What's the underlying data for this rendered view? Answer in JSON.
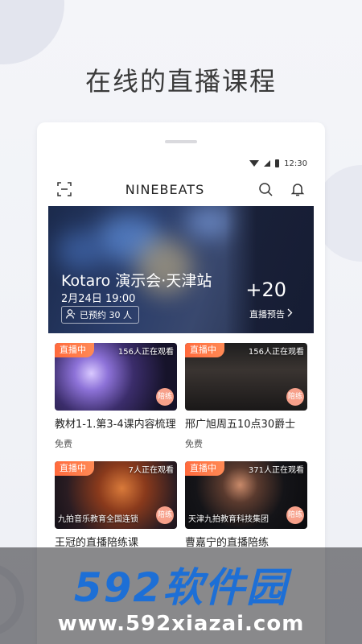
{
  "headline": "在线的直播课程",
  "status": {
    "time": "12:30"
  },
  "nav": {
    "brand": "NINEBEATS"
  },
  "hero": {
    "title": "Kotaro 演示会·天津站",
    "date": "2月24日 19:00",
    "booked": "已预约 30 人",
    "count": "+20",
    "link": "直播预告"
  },
  "cards": [
    {
      "tag": "直播中",
      "viewers": "156人正在观看",
      "title": "教材1-1.第3-4课内容梳理",
      "price": "免费",
      "badge": "陪练",
      "overlay": ""
    },
    {
      "tag": "直播中",
      "viewers": "156人正在观看",
      "title": "邢广旭周五10点30爵士",
      "price": "免费",
      "badge": "陪练",
      "overlay": ""
    },
    {
      "tag": "直播中",
      "viewers": "7人正在观看",
      "title": "王冠的直播陪练课",
      "price": "",
      "badge": "陪练",
      "overlay": "九拍音乐教育全国连锁"
    },
    {
      "tag": "直播中",
      "viewers": "371人正在观看",
      "title": "曹嘉宁的直播陪练",
      "price": "",
      "badge": "陪练",
      "overlay": "天津九拍教育科技集团"
    }
  ],
  "watermark": {
    "big": "592软件园",
    "small": "www.592xiazai.com"
  },
  "colors": {
    "live_tag": "#ff6a3d",
    "badge": "#f7a08a",
    "watermark_blue": "#1d6fd6"
  },
  "icons": [
    "scan-icon",
    "search-icon",
    "bell-icon",
    "wifi-icon",
    "signal-icon",
    "battery-icon",
    "user-icon",
    "chevron-right-icon"
  ]
}
